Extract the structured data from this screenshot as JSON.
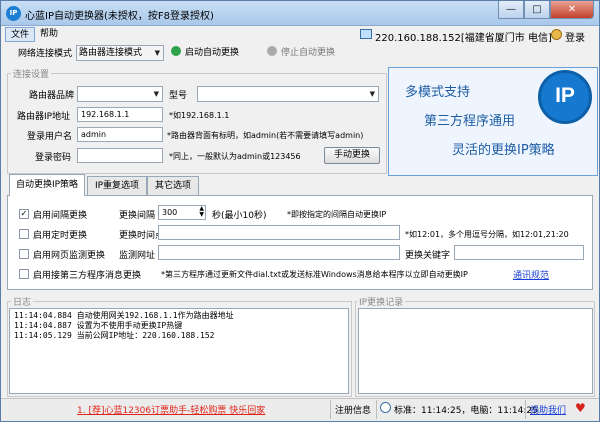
{
  "window": {
    "title": "心蓝IP自动更换器(未授权，按F8登录授权)",
    "minimize_glyph": "—",
    "maximize_glyph": "□",
    "close_glyph": "✕"
  },
  "menu": {
    "file": "文件",
    "help": "帮助"
  },
  "status_ip": "220.160.188.152[福建省厦门市 电信]",
  "login_label": "登录",
  "toolbar": {
    "mode_label": "网络连接模式",
    "mode_value": "路由器连接模式",
    "start_label": "启动自动更换",
    "stop_label": "停止自动更换"
  },
  "connection": {
    "group_title": "连接设置",
    "brand_label": "路由器品牌",
    "brand_value": "",
    "model_label": "型号",
    "model_value": "",
    "ip_label": "路由器IP地址",
    "ip_value": "192.168.1.1",
    "ip_hint": "*如192.168.1.1",
    "user_label": "登录用户名",
    "user_value": "admin",
    "user_hint": "*路由器背面有标明，如admin(若不需要请填写admin)",
    "pass_label": "登录密码",
    "pass_value": "",
    "pass_hint": "*同上，一般默认为admin或123456",
    "manual_button": "手动更换"
  },
  "promo": {
    "line1": "多模式支持",
    "line2": "第三方程序通用",
    "line3": "灵活的更换IP策略",
    "logo_text": "IP"
  },
  "tabs": [
    "自动更换IP策略",
    "IP重复选项",
    "其它选项"
  ],
  "policy": {
    "interval_check": "启用间隔更换",
    "interval_label": "更换间隔",
    "interval_value": "300",
    "interval_unit": "秒(最小10秒)",
    "interval_hint": "*即按指定的间隔自动更换IP",
    "timed_check": "启用定时更换",
    "timed_label": "更换时间点",
    "timed_value": "",
    "timed_hint": "*如12:01，多个用逗号分隔，如12:01,21:20",
    "web_check": "启用网页监测更换",
    "web_label": "监测网址",
    "web_value": "",
    "keyword_label": "更换关键字",
    "keyword_value": "",
    "thirdparty_check": "启用接第三方程序消息更换",
    "thirdparty_hint": "*第三方程序通过更新文件dial.txt或发送标准Windows消息给本程序以立即自动更换IP",
    "thirdparty_link": "通讯规范",
    "check_mark": "✓"
  },
  "log": {
    "title": "日志",
    "lines": [
      "11:14:04.884 自动使用网关192.168.1.1作为路由器地址",
      "11:14:04.887 设置为不使用手动更换IP热键",
      "11:14:05.129 当前公网IP地址：220.160.188.152"
    ]
  },
  "iplog": {
    "title": "IP更换记录"
  },
  "statusbar": {
    "ad": "1. [荐]心蓝12306订票助手-轻松购票 快乐回家",
    "register": "注册信息",
    "time_text": "标准：11:14:25，电脑：11:14:25",
    "donate": "捐助我们"
  }
}
